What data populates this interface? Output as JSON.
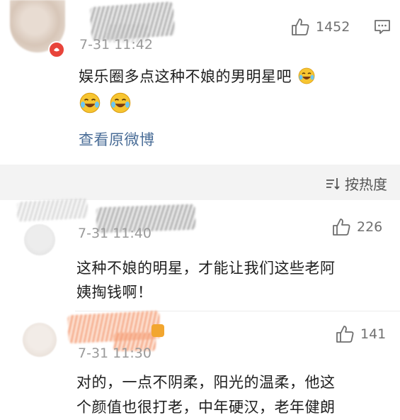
{
  "comment1": {
    "time": "7-31 11:42",
    "likes": "1452",
    "text": "娱乐圈多点这种不娘的男明星吧",
    "view_link": "查看原微博"
  },
  "sort": {
    "label": "按热度"
  },
  "comment2": {
    "time": "7-31 11:40",
    "likes": "226",
    "text_line1": "这种不娘的明星，才能让我们这些老阿",
    "text_line2": "姨掏钱啊！"
  },
  "comment3": {
    "time": "7-31 11:30",
    "likes": "141",
    "text_line1": "对的，一点不阴柔，阳光的温柔，他这",
    "text_line2": "个颜值也很打老，中年硬汉，老年健朗"
  },
  "icons": {
    "like": "thumbs-up-icon",
    "comment": "comment-icon",
    "sort": "sort-icon",
    "emoji": "laugh-cry-emoji-icon",
    "badge": "red-badge-icon"
  },
  "colors": {
    "link": "#4a6d97",
    "gray_text": "#9a9a9a",
    "band": "#f3f3f3",
    "emoji_yellow": "#f7c531",
    "badge_red": "#e8443a"
  }
}
